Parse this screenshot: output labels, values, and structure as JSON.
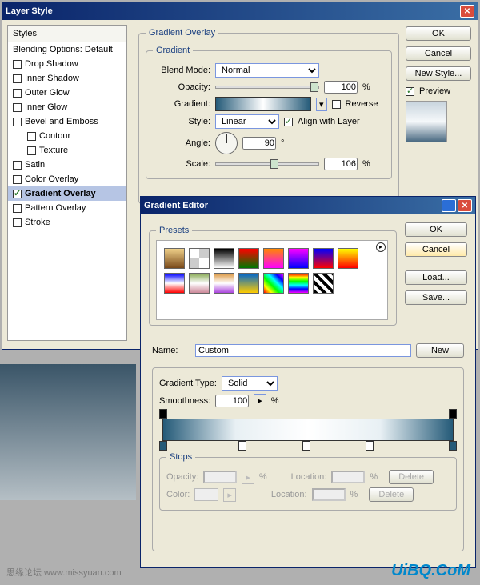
{
  "layerStyle": {
    "title": "Layer Style",
    "stylesHeader": "Styles",
    "blendingOptions": "Blending Options: Default",
    "items": [
      "Drop Shadow",
      "Inner Shadow",
      "Outer Glow",
      "Inner Glow",
      "Bevel and Emboss",
      "Contour",
      "Texture",
      "Satin",
      "Color Overlay",
      "Gradient Overlay",
      "Pattern Overlay",
      "Stroke"
    ],
    "buttons": {
      "ok": "OK",
      "cancel": "Cancel",
      "newStyle": "New Style...",
      "preview": "Preview"
    }
  },
  "gradientOverlay": {
    "title": "Gradient Overlay",
    "section": "Gradient",
    "blendModeLabel": "Blend Mode:",
    "blendMode": "Normal",
    "opacityLabel": "Opacity:",
    "opacity": "100",
    "pct": "%",
    "gradientLabel": "Gradient:",
    "reverse": "Reverse",
    "styleLabel": "Style:",
    "style": "Linear",
    "align": "Align with Layer",
    "angleLabel": "Angle:",
    "angle": "90",
    "deg": "°",
    "scaleLabel": "Scale:",
    "scale": "106"
  },
  "gradientEditor": {
    "title": "Gradient Editor",
    "presets": "Presets",
    "nameLabel": "Name:",
    "name": "Custom",
    "new": "New",
    "gradTypeLabel": "Gradient Type:",
    "gradType": "Solid",
    "smoothLabel": "Smoothness:",
    "smooth": "100",
    "pct": "%",
    "stops": "Stops",
    "opacityLabel": "Opacity:",
    "locationLabel": "Location:",
    "colorLabel": "Color:",
    "delete": "Delete",
    "buttons": {
      "ok": "OK",
      "cancel": "Cancel",
      "load": "Load...",
      "save": "Save..."
    }
  },
  "watermark": "UiBQ.CoM",
  "watermark2": "思缘论坛  www.missyuan.com"
}
